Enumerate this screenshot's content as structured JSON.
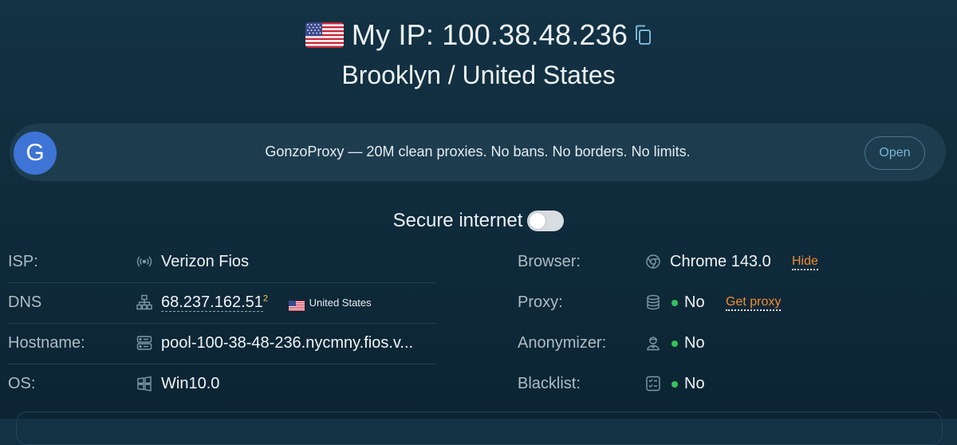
{
  "header": {
    "ip_title": "My IP: 100.38.48.236",
    "location": "Brooklyn / United States",
    "flag_icon": "us-flag-icon",
    "copy_icon": "copy-icon"
  },
  "promo": {
    "logo_letter": "G",
    "text": "GonzoProxy — 20M clean proxies. No bans. No borders. No limits.",
    "button_label": "Open"
  },
  "secure": {
    "label": "Secure internet",
    "enabled": false
  },
  "left_rows": [
    {
      "label": "ISP:",
      "value": "Verizon Fios",
      "icon": "broadcast-icon"
    },
    {
      "label": "DNS",
      "value": "68.237.162.51",
      "sup": "2",
      "country": "United States",
      "icon": "network-icon"
    },
    {
      "label": "Hostname:",
      "value": "pool-100-38-48-236.nycmny.fios.v...",
      "icon": "server-icon"
    },
    {
      "label": "OS:",
      "value": "Win10.0",
      "icon": "windows-icon"
    }
  ],
  "right_rows": [
    {
      "label": "Browser:",
      "value": "Chrome 143.0",
      "link": "Hide",
      "icon": "chrome-icon"
    },
    {
      "label": "Proxy:",
      "value": "No",
      "link": "Get proxy",
      "icon": "database-icon"
    },
    {
      "label": "Anonymizer:",
      "value": "No",
      "icon": "spy-icon"
    },
    {
      "label": "Blacklist:",
      "value": "No",
      "icon": "checklist-icon"
    }
  ],
  "colors": {
    "background": "#133244",
    "promo_bg": "#1d3d4f",
    "accent_link": "#f48b33",
    "status_ok": "#35c15a",
    "logo_bg": "#3d74d6"
  }
}
